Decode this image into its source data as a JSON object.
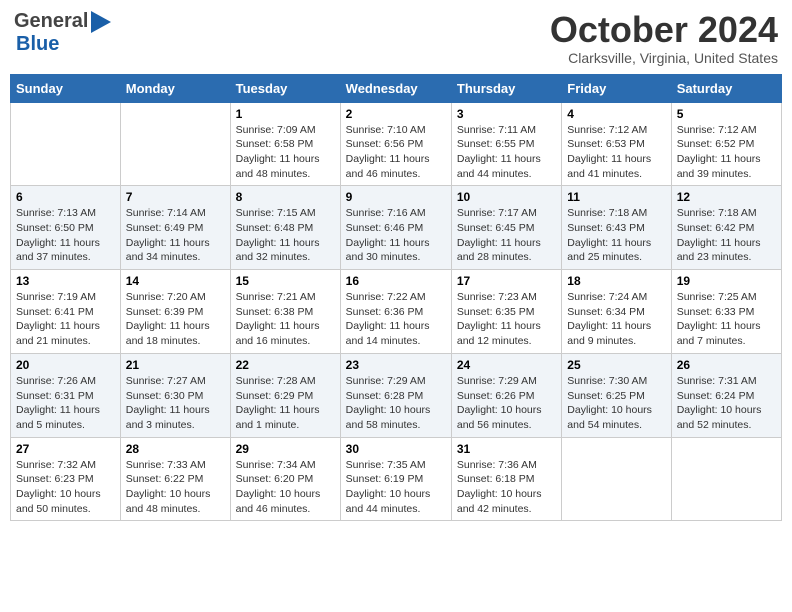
{
  "header": {
    "logo_general": "General",
    "logo_blue": "Blue",
    "month": "October 2024",
    "location": "Clarksville, Virginia, United States"
  },
  "days_of_week": [
    "Sunday",
    "Monday",
    "Tuesday",
    "Wednesday",
    "Thursday",
    "Friday",
    "Saturday"
  ],
  "weeks": [
    [
      {
        "day": "",
        "sunrise": "",
        "sunset": "",
        "daylight": ""
      },
      {
        "day": "",
        "sunrise": "",
        "sunset": "",
        "daylight": ""
      },
      {
        "day": "1",
        "sunrise": "Sunrise: 7:09 AM",
        "sunset": "Sunset: 6:58 PM",
        "daylight": "Daylight: 11 hours and 48 minutes."
      },
      {
        "day": "2",
        "sunrise": "Sunrise: 7:10 AM",
        "sunset": "Sunset: 6:56 PM",
        "daylight": "Daylight: 11 hours and 46 minutes."
      },
      {
        "day": "3",
        "sunrise": "Sunrise: 7:11 AM",
        "sunset": "Sunset: 6:55 PM",
        "daylight": "Daylight: 11 hours and 44 minutes."
      },
      {
        "day": "4",
        "sunrise": "Sunrise: 7:12 AM",
        "sunset": "Sunset: 6:53 PM",
        "daylight": "Daylight: 11 hours and 41 minutes."
      },
      {
        "day": "5",
        "sunrise": "Sunrise: 7:12 AM",
        "sunset": "Sunset: 6:52 PM",
        "daylight": "Daylight: 11 hours and 39 minutes."
      }
    ],
    [
      {
        "day": "6",
        "sunrise": "Sunrise: 7:13 AM",
        "sunset": "Sunset: 6:50 PM",
        "daylight": "Daylight: 11 hours and 37 minutes."
      },
      {
        "day": "7",
        "sunrise": "Sunrise: 7:14 AM",
        "sunset": "Sunset: 6:49 PM",
        "daylight": "Daylight: 11 hours and 34 minutes."
      },
      {
        "day": "8",
        "sunrise": "Sunrise: 7:15 AM",
        "sunset": "Sunset: 6:48 PM",
        "daylight": "Daylight: 11 hours and 32 minutes."
      },
      {
        "day": "9",
        "sunrise": "Sunrise: 7:16 AM",
        "sunset": "Sunset: 6:46 PM",
        "daylight": "Daylight: 11 hours and 30 minutes."
      },
      {
        "day": "10",
        "sunrise": "Sunrise: 7:17 AM",
        "sunset": "Sunset: 6:45 PM",
        "daylight": "Daylight: 11 hours and 28 minutes."
      },
      {
        "day": "11",
        "sunrise": "Sunrise: 7:18 AM",
        "sunset": "Sunset: 6:43 PM",
        "daylight": "Daylight: 11 hours and 25 minutes."
      },
      {
        "day": "12",
        "sunrise": "Sunrise: 7:18 AM",
        "sunset": "Sunset: 6:42 PM",
        "daylight": "Daylight: 11 hours and 23 minutes."
      }
    ],
    [
      {
        "day": "13",
        "sunrise": "Sunrise: 7:19 AM",
        "sunset": "Sunset: 6:41 PM",
        "daylight": "Daylight: 11 hours and 21 minutes."
      },
      {
        "day": "14",
        "sunrise": "Sunrise: 7:20 AM",
        "sunset": "Sunset: 6:39 PM",
        "daylight": "Daylight: 11 hours and 18 minutes."
      },
      {
        "day": "15",
        "sunrise": "Sunrise: 7:21 AM",
        "sunset": "Sunset: 6:38 PM",
        "daylight": "Daylight: 11 hours and 16 minutes."
      },
      {
        "day": "16",
        "sunrise": "Sunrise: 7:22 AM",
        "sunset": "Sunset: 6:36 PM",
        "daylight": "Daylight: 11 hours and 14 minutes."
      },
      {
        "day": "17",
        "sunrise": "Sunrise: 7:23 AM",
        "sunset": "Sunset: 6:35 PM",
        "daylight": "Daylight: 11 hours and 12 minutes."
      },
      {
        "day": "18",
        "sunrise": "Sunrise: 7:24 AM",
        "sunset": "Sunset: 6:34 PM",
        "daylight": "Daylight: 11 hours and 9 minutes."
      },
      {
        "day": "19",
        "sunrise": "Sunrise: 7:25 AM",
        "sunset": "Sunset: 6:33 PM",
        "daylight": "Daylight: 11 hours and 7 minutes."
      }
    ],
    [
      {
        "day": "20",
        "sunrise": "Sunrise: 7:26 AM",
        "sunset": "Sunset: 6:31 PM",
        "daylight": "Daylight: 11 hours and 5 minutes."
      },
      {
        "day": "21",
        "sunrise": "Sunrise: 7:27 AM",
        "sunset": "Sunset: 6:30 PM",
        "daylight": "Daylight: 11 hours and 3 minutes."
      },
      {
        "day": "22",
        "sunrise": "Sunrise: 7:28 AM",
        "sunset": "Sunset: 6:29 PM",
        "daylight": "Daylight: 11 hours and 1 minute."
      },
      {
        "day": "23",
        "sunrise": "Sunrise: 7:29 AM",
        "sunset": "Sunset: 6:28 PM",
        "daylight": "Daylight: 10 hours and 58 minutes."
      },
      {
        "day": "24",
        "sunrise": "Sunrise: 7:29 AM",
        "sunset": "Sunset: 6:26 PM",
        "daylight": "Daylight: 10 hours and 56 minutes."
      },
      {
        "day": "25",
        "sunrise": "Sunrise: 7:30 AM",
        "sunset": "Sunset: 6:25 PM",
        "daylight": "Daylight: 10 hours and 54 minutes."
      },
      {
        "day": "26",
        "sunrise": "Sunrise: 7:31 AM",
        "sunset": "Sunset: 6:24 PM",
        "daylight": "Daylight: 10 hours and 52 minutes."
      }
    ],
    [
      {
        "day": "27",
        "sunrise": "Sunrise: 7:32 AM",
        "sunset": "Sunset: 6:23 PM",
        "daylight": "Daylight: 10 hours and 50 minutes."
      },
      {
        "day": "28",
        "sunrise": "Sunrise: 7:33 AM",
        "sunset": "Sunset: 6:22 PM",
        "daylight": "Daylight: 10 hours and 48 minutes."
      },
      {
        "day": "29",
        "sunrise": "Sunrise: 7:34 AM",
        "sunset": "Sunset: 6:20 PM",
        "daylight": "Daylight: 10 hours and 46 minutes."
      },
      {
        "day": "30",
        "sunrise": "Sunrise: 7:35 AM",
        "sunset": "Sunset: 6:19 PM",
        "daylight": "Daylight: 10 hours and 44 minutes."
      },
      {
        "day": "31",
        "sunrise": "Sunrise: 7:36 AM",
        "sunset": "Sunset: 6:18 PM",
        "daylight": "Daylight: 10 hours and 42 minutes."
      },
      {
        "day": "",
        "sunrise": "",
        "sunset": "",
        "daylight": ""
      },
      {
        "day": "",
        "sunrise": "",
        "sunset": "",
        "daylight": ""
      }
    ]
  ]
}
